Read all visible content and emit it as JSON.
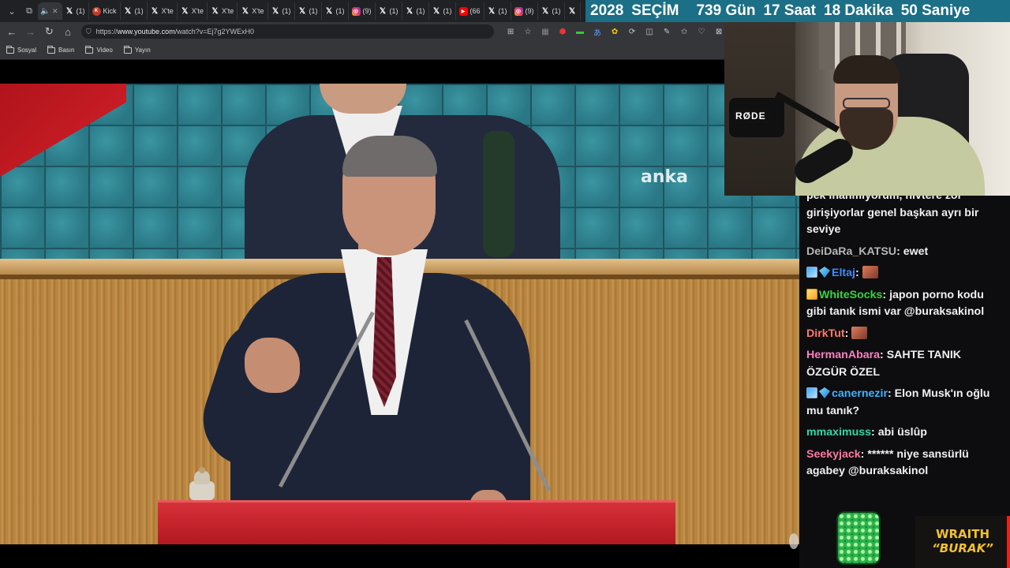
{
  "browser": {
    "tabs": [
      {
        "icon": "x",
        "label": "(1)"
      },
      {
        "icon": "kick",
        "label": "Kick"
      },
      {
        "icon": "x",
        "label": "(1)"
      },
      {
        "icon": "x",
        "label": "X'te"
      },
      {
        "icon": "x",
        "label": "X'te"
      },
      {
        "icon": "x",
        "label": "X'te"
      },
      {
        "icon": "x",
        "label": "X'te"
      },
      {
        "icon": "x",
        "label": "(1)"
      },
      {
        "icon": "x",
        "label": "(1)"
      },
      {
        "icon": "x",
        "label": "(1)"
      },
      {
        "icon": "instagram",
        "label": "(9)"
      },
      {
        "icon": "x",
        "label": "(1)"
      },
      {
        "icon": "x",
        "label": "(1)"
      },
      {
        "icon": "x",
        "label": "(1)"
      },
      {
        "icon": "youtube",
        "label": "(66"
      },
      {
        "icon": "x",
        "label": "(1)"
      },
      {
        "icon": "instagram",
        "label": "(9)"
      },
      {
        "icon": "x",
        "label": "(1)"
      },
      {
        "icon": "x",
        "label": ""
      }
    ],
    "url_prefix": "https://",
    "url_host": "www.youtube.com",
    "url_path": "/watch?v=Ej7g2YWExH0",
    "bookmarks": [
      "Sosyal",
      "Basın",
      "Video",
      "Yayın"
    ]
  },
  "countdown": {
    "year": "2028",
    "label": "SEÇİM",
    "days": "739 Gün",
    "hours": "17 Saat",
    "minutes": "18 Dakika",
    "seconds": "50 Saniye"
  },
  "video": {
    "watermark": "anka"
  },
  "webcam": {
    "mic_brand": "RØDE"
  },
  "chat": {
    "messages": [
      {
        "user": "",
        "user_color": "#f1f1f1",
        "text": "pek inanmıyorum, nivtere zor girişiyorlar genel başkan ayrı bir seviye",
        "badges": [],
        "emote": false
      },
      {
        "user": "DeiDaRa_KATSU",
        "user_color": "#b6b6b6",
        "text": "ewet",
        "badges": [],
        "emote": false
      },
      {
        "user": "Eltaj",
        "user_color": "#3a8cff",
        "text": "",
        "badges": [
          "chart",
          "diamond"
        ],
        "emote": true
      },
      {
        "user": "WhiteSocks",
        "user_color": "#36d43d",
        "text": "japon porno kodu gibi tanık ismi var @buraksakinol",
        "badges": [
          "pencil"
        ],
        "emote": false
      },
      {
        "user": "DirkTut",
        "user_color": "#ff7a6b",
        "text": "",
        "badges": [],
        "emote": true
      },
      {
        "user": "HermanAbara",
        "user_color": "#ff7fc4",
        "text": "SAHTE TANIK ÖZGÜR ÖZEL",
        "badges": [],
        "emote": false
      },
      {
        "user": "canernezir",
        "user_color": "#3fb4ff",
        "text": "Elon Musk'ın oğlu mu tanık?",
        "badges": [
          "chart",
          "diamond"
        ],
        "emote": false
      },
      {
        "user": "mmaximuss",
        "user_color": "#34d6a4",
        "text": "abi üslûp",
        "badges": [],
        "emote": false
      },
      {
        "user": "Seekyjack",
        "user_color": "#ff7aa0",
        "text": "****** niye sansürlü agabey @buraksakinol",
        "badges": [],
        "emote": false
      }
    ]
  },
  "branding": {
    "line1": "WRAITH",
    "line2": "“BURAK”"
  },
  "colors": {
    "countdown_bg": "#1b6f86",
    "chat_bg": "#0d0d0f",
    "lectern_red": "#c3202a"
  }
}
